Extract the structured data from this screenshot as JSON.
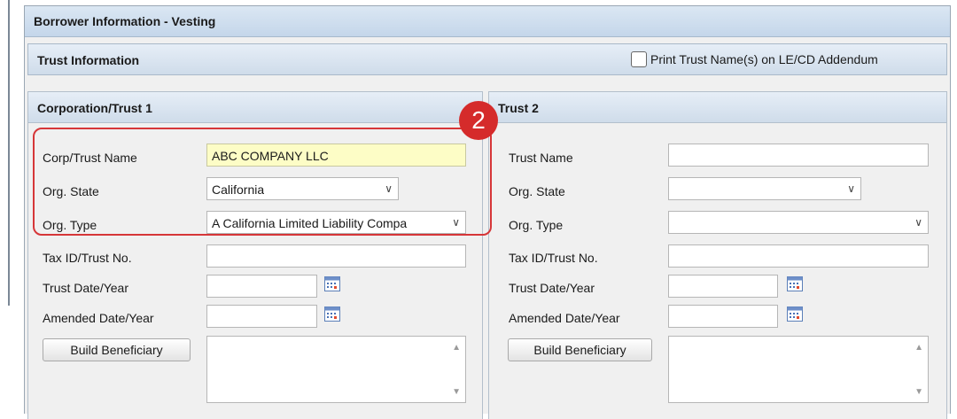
{
  "header": {
    "title": "Borrower Information - Vesting"
  },
  "trust_info": {
    "title": "Trust Information",
    "print_checkbox_label": "Print Trust Name(s) on LE/CD Addendum",
    "print_checked": false
  },
  "trust1": {
    "title": "Corporation/Trust 1",
    "name_label": "Corp/Trust Name",
    "name_value": "ABC COMPANY LLC",
    "state_label": "Org. State",
    "state_value": "California",
    "type_label": "Org. Type",
    "type_value": "A California Limited Liability Compa",
    "taxid_label": "Tax ID/Trust No.",
    "taxid_value": "",
    "date_label": "Trust Date/Year",
    "date_value": "",
    "amended_label": "Amended Date/Year",
    "amended_value": "",
    "build_button": "Build Beneficiary"
  },
  "trust2": {
    "title": "Trust 2",
    "name_label": "Trust Name",
    "name_value": "",
    "state_label": "Org. State",
    "state_value": "",
    "type_label": "Org. Type",
    "type_value": "",
    "taxid_label": "Tax ID/Trust No.",
    "taxid_value": "",
    "date_label": "Trust Date/Year",
    "date_value": "",
    "amended_label": "Amended Date/Year",
    "amended_value": "",
    "build_button": "Build Beneficiary"
  },
  "callout": {
    "number": "2",
    "color": "#d52b2b"
  },
  "icons": {
    "calendar": "calendar-icon",
    "dropdown": "chevron-down-icon",
    "scroll_up": "scroll-up-arrow-icon",
    "scroll_down": "scroll-down-arrow-icon"
  },
  "colors": {
    "header_bg": "#c4d6ea",
    "highlight_field": "#fdfdc6",
    "callout_border": "#d63638"
  }
}
